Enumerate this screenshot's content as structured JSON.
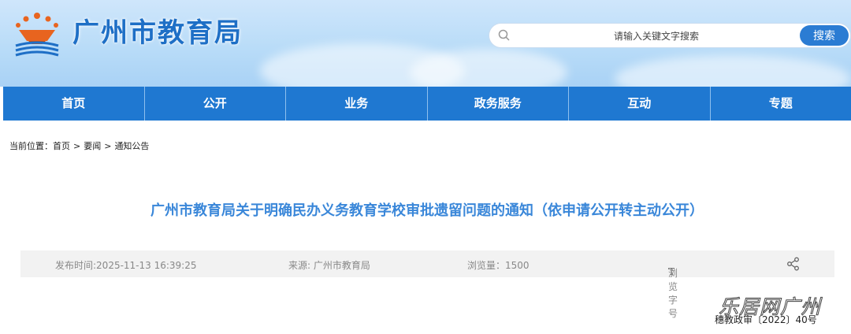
{
  "header": {
    "site_title": "广州市教育局",
    "search": {
      "placeholder": "请输入关键文字搜索",
      "button_label": "搜索"
    }
  },
  "nav": {
    "items": [
      "首页",
      "公开",
      "业务",
      "政务服务",
      "互动",
      "专题"
    ]
  },
  "breadcrumb": {
    "prefix": "当前位置：",
    "items": [
      "首页",
      "要闻",
      "通知公告"
    ],
    "separator": ">"
  },
  "article": {
    "title": "广州市教育局关于明确民办义务教育学校审批遗留问题的通知（依申请公开转主动公开）",
    "publish_time": "发布时间:2025-11-13 16:39:25",
    "source": "来源: 广州市教育局",
    "views": "浏览量：1500",
    "font_size_label": "浏览字号",
    "font_size_icon_char": "T",
    "doc_number": "穗教政审〔2022〕40号"
  },
  "watermark": "乐居网广州",
  "colors": {
    "nav_bg": "#1f78d1",
    "title_blue": "#3a87d9",
    "search_button": "#2b7cd3",
    "logo_orange": "#e8641f"
  },
  "icons": {
    "search": "search-icon",
    "share": "share-icon",
    "logo": "emblem-logo-icon"
  }
}
